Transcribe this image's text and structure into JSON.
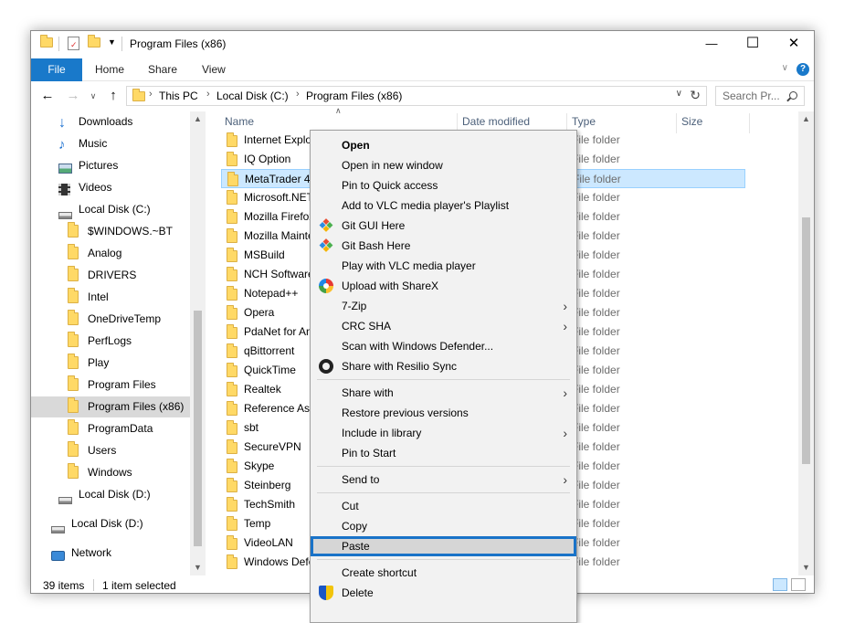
{
  "window": {
    "title": "Program Files (x86)",
    "minimize": "—",
    "maximize": "☐",
    "close": "✕"
  },
  "ribbon": {
    "file": "File",
    "tabs": [
      "Home",
      "Share",
      "View"
    ],
    "help": "?"
  },
  "address": {
    "crumbs": [
      "This PC",
      "Local Disk (C:)",
      "Program Files (x86)"
    ],
    "search_placeholder": "Search Pr..."
  },
  "sidebar": {
    "items": [
      {
        "label": "Downloads",
        "icon": "download-icon",
        "indent": 0
      },
      {
        "label": "Music",
        "icon": "music-icon",
        "indent": 0
      },
      {
        "label": "Pictures",
        "icon": "pictures-icon",
        "indent": 0
      },
      {
        "label": "Videos",
        "icon": "videos-icon",
        "indent": 0
      },
      {
        "label": "Local Disk (C:)",
        "icon": "drive-icon",
        "indent": 0
      },
      {
        "label": "$WINDOWS.~BT",
        "icon": "folder-icon",
        "indent": 1
      },
      {
        "label": "Analog",
        "icon": "folder-icon",
        "indent": 1
      },
      {
        "label": "DRIVERS",
        "icon": "folder-icon",
        "indent": 1
      },
      {
        "label": "Intel",
        "icon": "folder-icon",
        "indent": 1
      },
      {
        "label": "OneDriveTemp",
        "icon": "folder-icon",
        "indent": 1
      },
      {
        "label": "PerfLogs",
        "icon": "folder-icon",
        "indent": 1
      },
      {
        "label": "Play",
        "icon": "folder-icon",
        "indent": 1
      },
      {
        "label": "Program Files",
        "icon": "folder-icon",
        "indent": 1
      },
      {
        "label": "Program Files (x86)",
        "icon": "folder-icon",
        "indent": 1,
        "selected": true
      },
      {
        "label": "ProgramData",
        "icon": "folder-icon",
        "indent": 1
      },
      {
        "label": "Users",
        "icon": "folder-icon",
        "indent": 1
      },
      {
        "label": "Windows",
        "icon": "folder-icon",
        "indent": 1
      },
      {
        "label": "Local Disk (D:)",
        "icon": "drive-icon",
        "indent": 0
      },
      {
        "label": "Local Disk (D:)",
        "icon": "drive-icon",
        "indent": -1
      },
      {
        "label": "Network",
        "icon": "network-icon",
        "indent": -1
      }
    ]
  },
  "columns": {
    "name": "Name",
    "date": "Date modified",
    "type": "Type",
    "size": "Size"
  },
  "files": [
    {
      "name": "Internet Explorer",
      "type": "File folder"
    },
    {
      "name": "IQ Option",
      "type": "File folder"
    },
    {
      "name": "MetaTrader 4",
      "type": "File folder",
      "selected": true
    },
    {
      "name": "Microsoft.NET",
      "type": "File folder"
    },
    {
      "name": "Mozilla Firefox",
      "type": "File folder"
    },
    {
      "name": "Mozilla Maintenance Service",
      "type": "File folder"
    },
    {
      "name": "MSBuild",
      "type": "File folder"
    },
    {
      "name": "NCH Software",
      "type": "File folder"
    },
    {
      "name": "Notepad++",
      "type": "File folder"
    },
    {
      "name": "Opera",
      "type": "File folder"
    },
    {
      "name": "PdaNet for Android",
      "type": "File folder"
    },
    {
      "name": "qBittorrent",
      "type": "File folder"
    },
    {
      "name": "QuickTime",
      "type": "File folder"
    },
    {
      "name": "Realtek",
      "type": "File folder"
    },
    {
      "name": "Reference Assemblies",
      "type": "File folder"
    },
    {
      "name": "sbt",
      "type": "File folder"
    },
    {
      "name": "SecureVPN",
      "type": "File folder"
    },
    {
      "name": "Skype",
      "type": "File folder"
    },
    {
      "name": "Steinberg",
      "type": "File folder"
    },
    {
      "name": "TechSmith",
      "type": "File folder"
    },
    {
      "name": "Temp",
      "type": "File folder"
    },
    {
      "name": "VideoLAN",
      "type": "File folder"
    },
    {
      "name": "Windows Defender",
      "type": "File folder"
    }
  ],
  "status": {
    "count": "39 items",
    "selected": "1 item selected"
  },
  "context_menu": {
    "items": [
      {
        "label": "Open",
        "bold": true
      },
      {
        "label": "Open in new window"
      },
      {
        "label": "Pin to Quick access"
      },
      {
        "label": "Add to VLC media player's Playlist"
      },
      {
        "label": "Git GUI Here",
        "icon": "git-icon"
      },
      {
        "label": "Git Bash Here",
        "icon": "git-icon"
      },
      {
        "label": "Play with VLC media player"
      },
      {
        "label": "Upload with ShareX",
        "icon": "sharex-icon"
      },
      {
        "label": "7-Zip",
        "submenu": true
      },
      {
        "label": "CRC SHA",
        "submenu": true
      },
      {
        "label": "Scan with Windows Defender..."
      },
      {
        "label": "Share with Resilio Sync",
        "icon": "resilio-icon"
      },
      {
        "separator": true
      },
      {
        "label": "Share with",
        "submenu": true
      },
      {
        "label": "Restore previous versions"
      },
      {
        "label": "Include in library",
        "submenu": true
      },
      {
        "label": "Pin to Start"
      },
      {
        "separator": true
      },
      {
        "label": "Send to",
        "submenu": true
      },
      {
        "separator": true
      },
      {
        "label": "Cut"
      },
      {
        "label": "Copy"
      },
      {
        "label": "Paste",
        "highlighted": true
      },
      {
        "separator": true
      },
      {
        "label": "Create shortcut"
      },
      {
        "label": "Delete",
        "icon": "shield-icon"
      }
    ]
  },
  "colors": {
    "accent": "#1979ca",
    "selection": "#cce8ff",
    "highlight_outline": "#1a73c8",
    "folder": "#ffd966"
  }
}
